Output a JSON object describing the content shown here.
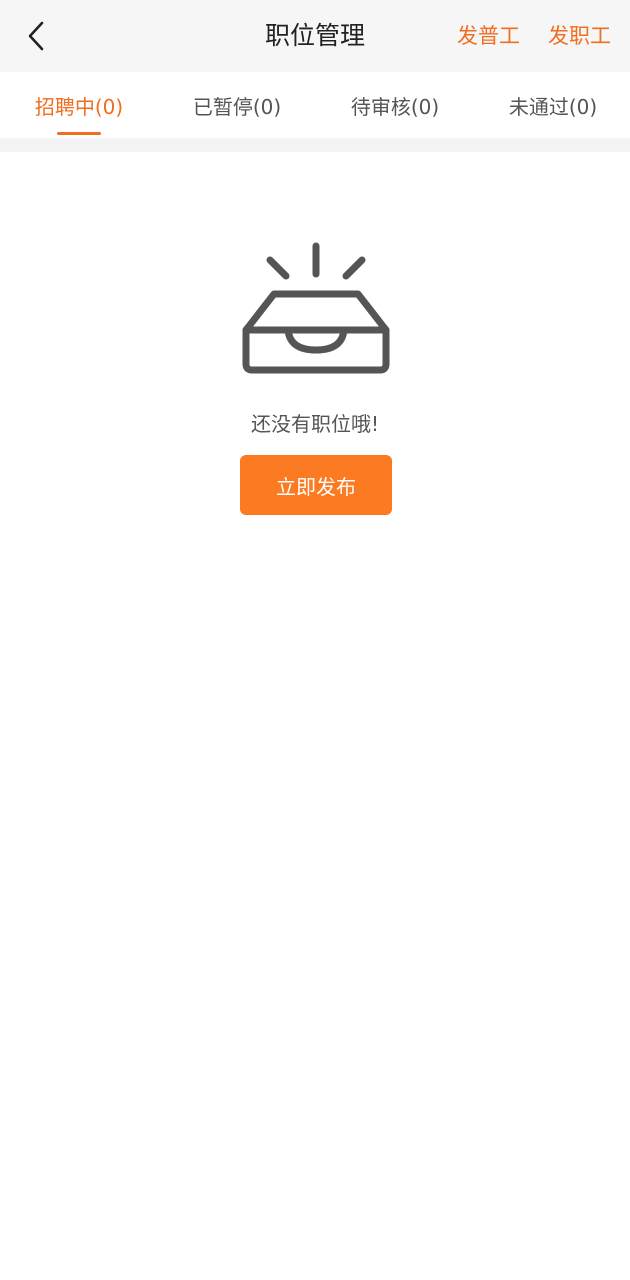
{
  "header": {
    "title": "职位管理",
    "back_icon": "chevron-left-icon",
    "actions": [
      {
        "label": "发普工"
      },
      {
        "label": "发职工"
      }
    ]
  },
  "tabs": [
    {
      "label": "招聘中(0)",
      "active": true
    },
    {
      "label": "已暂停(0)",
      "active": false
    },
    {
      "label": "待审核(0)",
      "active": false
    },
    {
      "label": "未通过(0)",
      "active": false
    }
  ],
  "empty_state": {
    "icon": "empty-inbox-icon",
    "message": "还没有职位哦!",
    "button_label": "立即发布"
  },
  "colors": {
    "accent": "#f26d1f",
    "button": "#fb7a22",
    "header_bg": "#f6f6f6",
    "text_primary": "#222222",
    "text_secondary": "#555555",
    "icon": "#555555"
  }
}
